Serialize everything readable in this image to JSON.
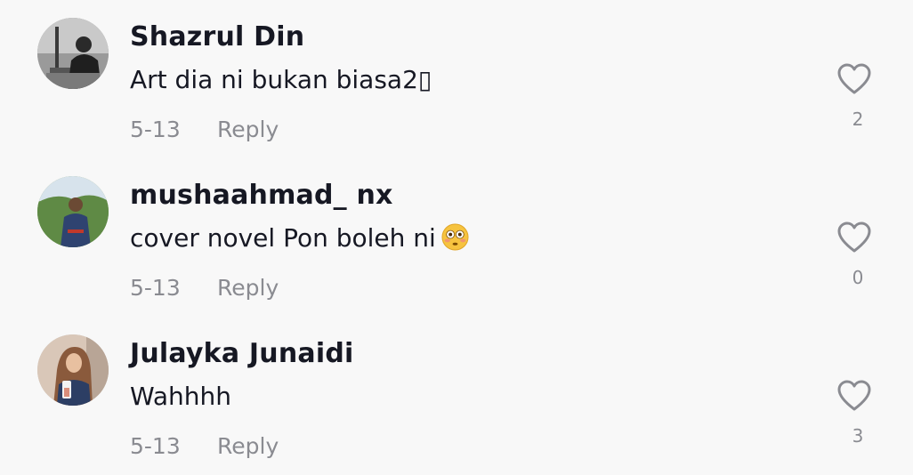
{
  "comments": [
    {
      "username": "Shazrul Din",
      "text": "Art dia ni bukan biasa2▯",
      "date": "5-13",
      "reply_label": "Reply",
      "like_count": "2",
      "like_icon": "heart-outline-icon"
    },
    {
      "username": "mushaahmad_ nx",
      "text": "cover novel Pon boleh ni",
      "emoji": "flushed-face-emoji",
      "date": "5-13",
      "reply_label": "Reply",
      "like_count": "0",
      "like_icon": "heart-outline-icon"
    },
    {
      "username": "Julayka Junaidi",
      "text": "Wahhhh",
      "date": "5-13",
      "reply_label": "Reply",
      "like_count": "3",
      "like_icon": "heart-outline-icon"
    }
  ],
  "colors": {
    "background": "#f8f8f8",
    "primary_text": "#161823",
    "secondary_text": "#8a8b91"
  }
}
